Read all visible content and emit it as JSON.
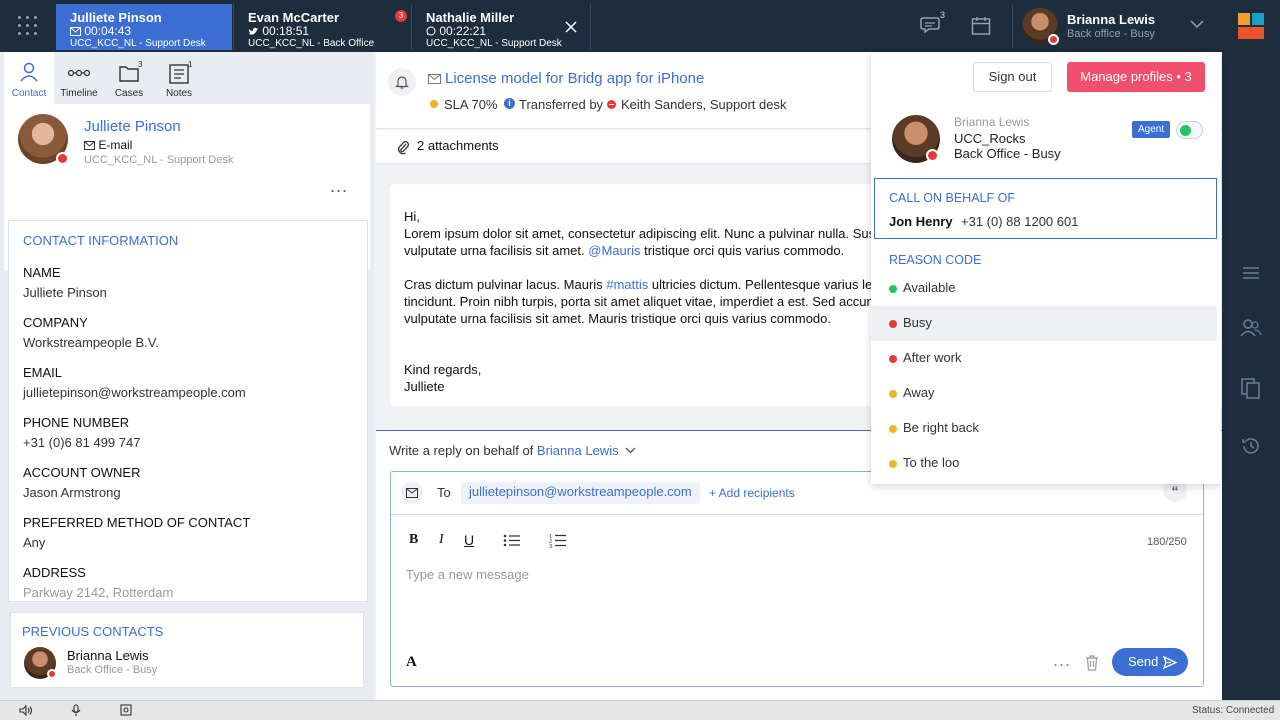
{
  "topbar": {
    "calls": [
      {
        "name": "Julliete Pinson",
        "time": "00:04:43",
        "queue": "UCC_KCC_NL - Support Desk"
      },
      {
        "name": "Evan McCarter",
        "time": "00:18:51",
        "queue": "UCC_KCC_NL - Back Office",
        "badge": "3"
      },
      {
        "name": "Nathalie Miller",
        "time": "00:22:21",
        "queue": "UCC_KCC_NL - Support Desk"
      }
    ],
    "chat_badge": "3",
    "user": {
      "name": "Brianna Lewis",
      "status": "Back office - Busy"
    }
  },
  "left": {
    "tabs": [
      {
        "label": "Contact"
      },
      {
        "label": "Timeline"
      },
      {
        "label": "Cases",
        "badge": "3"
      },
      {
        "label": "Notes",
        "badge": "1"
      }
    ],
    "contact": {
      "name": "Julliete Pinson",
      "channel": "E-mail",
      "queue": "UCC_KCC_NL - Support Desk",
      "more": "..."
    },
    "info_title": "CONTACT INFORMATION",
    "fields": [
      {
        "label": "NAME",
        "value": "Julliete Pinson"
      },
      {
        "label": "COMPANY",
        "value": "Workstreampeople B.V."
      },
      {
        "label": "EMAIL",
        "value": "jullietepinson@workstreampeople.com"
      },
      {
        "label": "PHONE NUMBER",
        "value": "+31 (0)6 81 499 747"
      },
      {
        "label": "ACCOUNT OWNER",
        "value": "Jason Armstrong"
      },
      {
        "label": "PREFERRED METHOD OF CONTACT",
        "value": "Any"
      },
      {
        "label": "ADDRESS",
        "value": "Parkway 2142, Rotterdam"
      }
    ],
    "prev_title": "PREVIOUS CONTACTS",
    "prev_contact": {
      "name": "Brianna Lewis",
      "status": "Back Office - Busy"
    }
  },
  "email": {
    "subject": "License model for Bridg app for iPhone",
    "sla": "SLA 70%",
    "transferred_label": "Transferred by",
    "transferred_by": "Keith Sanders, Support desk",
    "attachments": "2 attachments",
    "greeting": "Hi,",
    "p1_line1": "Lorem ipsum dolor sit amet, consectetur adipiscing elit. Nunc a pulvinar nulla. Sus",
    "p1_line2_a": "vulputate urna facilisis sit amet.",
    "p1_mention": "@Mauris",
    "p1_line2_b": "tristique orci quis varius commodo.",
    "p2_line1_a": "Cras dictum pulvinar lacus. Mauris",
    "p2_hashtag": "#mattis",
    "p2_line1_b": "ultricies dictum. Pellentesque varius lec",
    "p2_line2": "tincidunt. Proin nibh turpis, porta sit amet aliquet vitae, imperdiet a est. Sed accun",
    "p2_line3": "vulputate urna facilisis sit amet. Mauris tristique orci quis varius commodo.",
    "signoff1": "Kind regards,",
    "signoff2": "Julliete"
  },
  "reply": {
    "label": "Write a reply on behalf of",
    "agent": "Brianna Lewis",
    "to_label": "To",
    "to_value": "jullietepinson@workstreampeople.com",
    "add_recipients": "+ Add recipients",
    "counter": "180/250",
    "placeholder": "Type a new message",
    "send": "Send",
    "more": "..."
  },
  "profile": {
    "sign_out": "Sign out",
    "manage": "Manage profiles • 3",
    "name": "Brianna Lewis",
    "org": "UCC_Rocks",
    "status": "Back Office - Busy",
    "role_badge": "Agent",
    "call_title": "CALL ON BEHALF OF",
    "call_name": "Jon Henry",
    "call_number": "+31 (0) 88 1200 601",
    "reason_title": "REASON CODE",
    "reasons": [
      {
        "label": "Available",
        "color": "#22c55e"
      },
      {
        "label": "Busy",
        "color": "#e53935"
      },
      {
        "label": "After work",
        "color": "#e53935"
      },
      {
        "label": "Away",
        "color": "#f0b429"
      },
      {
        "label": "Be right back",
        "color": "#f0b429"
      },
      {
        "label": "To the loo",
        "color": "#f0b429"
      }
    ]
  },
  "statusbar": {
    "status": "Status: Connected"
  },
  "colors": {
    "accent": "#3b6fd4",
    "danger": "#f0506e",
    "topbar": "#1e2d3d"
  }
}
